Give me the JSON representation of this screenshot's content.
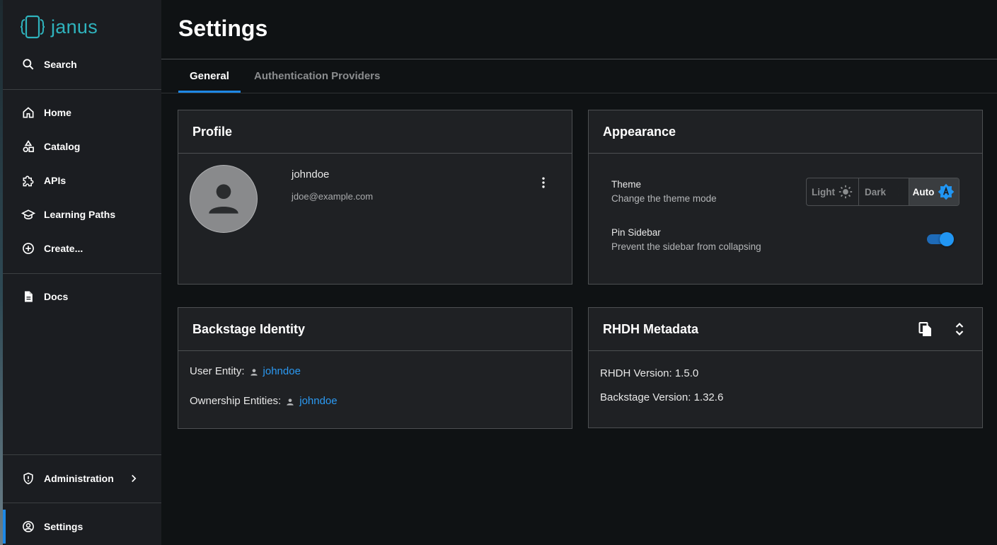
{
  "app": {
    "logo_text": "janus",
    "accent": "#2fb3bd",
    "primary": "#1e88e5"
  },
  "sidebar": {
    "search_label": "Search",
    "items": [
      {
        "label": "Home",
        "icon": "home-icon"
      },
      {
        "label": "Catalog",
        "icon": "catalog-icon"
      },
      {
        "label": "APIs",
        "icon": "puzzle-icon"
      },
      {
        "label": "Learning Paths",
        "icon": "school-icon"
      },
      {
        "label": "Create...",
        "icon": "add-circle-icon"
      },
      {
        "label": "Docs",
        "icon": "description-icon"
      }
    ],
    "administration_label": "Administration",
    "settings_label": "Settings"
  },
  "page": {
    "title": "Settings",
    "tabs": [
      {
        "label": "General",
        "active": true
      },
      {
        "label": "Authentication Providers",
        "active": false
      }
    ]
  },
  "profile": {
    "title": "Profile",
    "username": "johndoe",
    "email": "jdoe@example.com"
  },
  "appearance": {
    "title": "Appearance",
    "theme_label": "Theme",
    "theme_desc": "Change the theme mode",
    "theme_options": [
      "Light",
      "Dark",
      "Auto"
    ],
    "theme_selected": "Auto",
    "pin_label": "Pin Sidebar",
    "pin_desc": "Prevent the sidebar from collapsing",
    "pin_enabled": true
  },
  "identity": {
    "title": "Backstage Identity",
    "user_entity_label": "User Entity:",
    "user_entity_value": "johndoe",
    "ownership_label": "Ownership Entities:",
    "ownership_value": "johndoe"
  },
  "metadata": {
    "title": "RHDH Metadata",
    "rhdh_version": "RHDH Version: 1.5.0",
    "backstage_version": "Backstage Version: 1.32.6"
  }
}
